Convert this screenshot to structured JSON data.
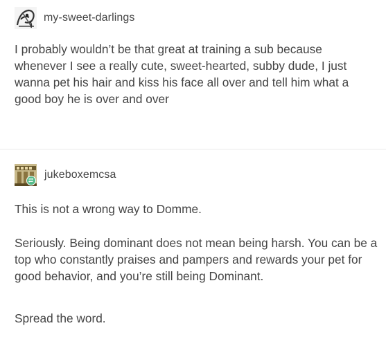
{
  "posts": [
    {
      "username": "my-sweet-darlings",
      "avatar_icon": "sketch-portrait-avatar",
      "text": "I probably wouldn’t be that great at training a sub because whenever I see a really cute, sweet-hearted, subby dude, I just wanna pet his hair and kiss his face all over and tell him what a good boy he is over and over"
    },
    {
      "username": "jukeboxemcsa",
      "avatar_icon": "building-avatar",
      "badge_icon": "reblog-icon",
      "badge_color": "#56bc8a",
      "paragraphs": [
        "This is not a wrong way to Domme.",
        "Seriously. Being dominant does not mean being harsh. You can be a top who constantly praises and pampers and rewards your pet for good behavior, and you’re still being Dominant.",
        "Spread the word."
      ]
    }
  ],
  "colors": {
    "text": "#444444",
    "divider": "#e9e9e9",
    "background": "#ffffff"
  }
}
